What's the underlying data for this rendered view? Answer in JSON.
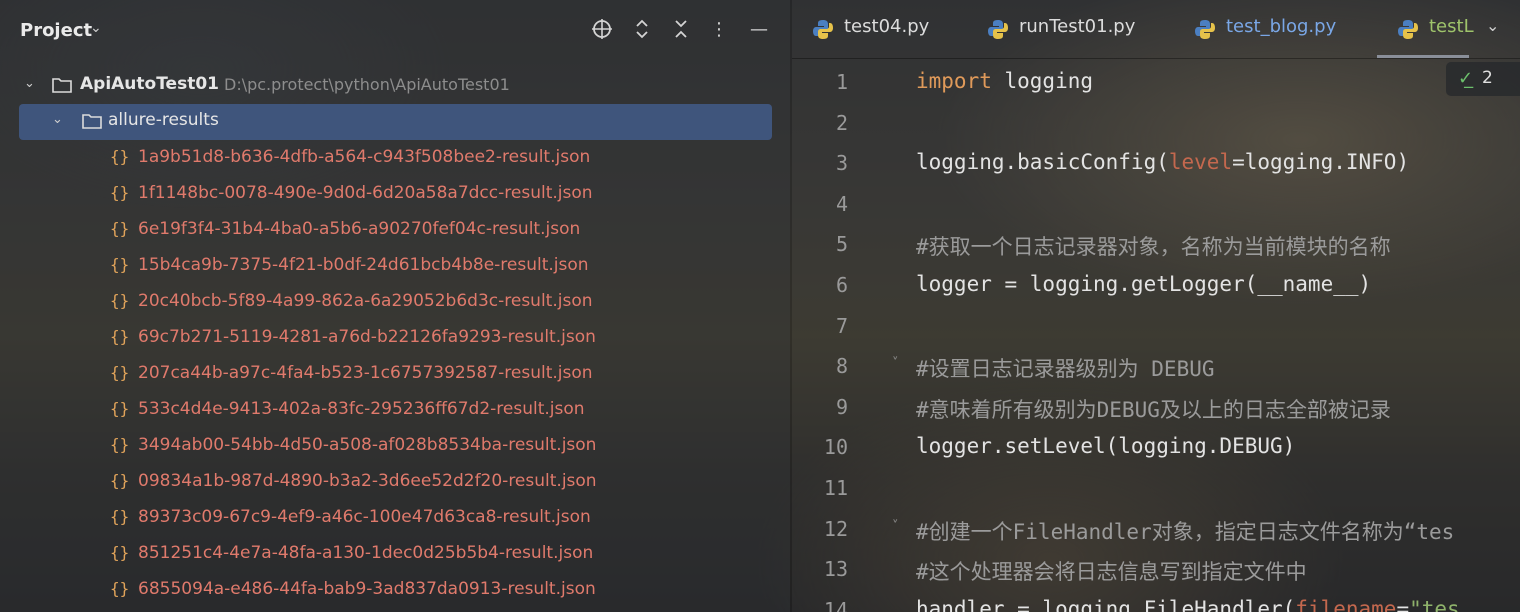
{
  "project_panel": {
    "title": "Project",
    "header_icons": [
      "locate-icon",
      "expand-collapse-icon",
      "collapse-all-icon",
      "more-icon",
      "minimize-icon"
    ],
    "root": {
      "name": "ApiAutoTest01",
      "path": "D:\\pc.protect\\python\\ApiAutoTest01"
    },
    "folder": {
      "name": "allure-results"
    },
    "files": [
      "1a9b51d8-b636-4dfb-a564-c943f508bee2-result.json",
      "1f1148bc-0078-490e-9d0d-6d20a58a7dcc-result.json",
      "6e19f3f4-31b4-4ba0-a5b6-a90270fef04c-result.json",
      "15b4ca9b-7375-4f21-b0df-24d61bcb4b8e-result.json",
      "20c40bcb-5f89-4a99-862a-6a29052b6d3c-result.json",
      "69c7b271-5119-4281-a76d-b22126fa9293-result.json",
      "207ca44b-a97c-4fa4-b523-1c6757392587-result.json",
      "533c4d4e-9413-402a-83fc-295236ff67d2-result.json",
      "3494ab00-54bb-4d50-a508-af028b8534ba-result.json",
      "09834a1b-987d-4890-b3a2-3d6ee52d2f20-result.json",
      "89373c09-67c9-4ef9-a46c-100e47d63ca8-result.json",
      "851251c4-4e7a-48fa-a130-1dec0d25b5b4-result.json",
      "6855094a-e486-44fa-bab9-3ad837da0913-result.json"
    ],
    "json_icon_glyph": "{}"
  },
  "editor": {
    "tabs": [
      {
        "label": "test04.py"
      },
      {
        "label": "runTest01.py"
      },
      {
        "label": "test_blog.py"
      },
      {
        "label": "testL"
      }
    ],
    "inspection_count": "2",
    "lines": [
      {
        "n": "1",
        "kw": "import",
        "rest": " logging"
      },
      {
        "n": "2"
      },
      {
        "n": "3",
        "a": "logging.basicConfig(",
        "param": "level",
        "b": "=logging.INFO)"
      },
      {
        "n": "4"
      },
      {
        "n": "5",
        "comment": "#获取一个日志记录器对象，名称为当前模块的名称"
      },
      {
        "n": "6",
        "text": "logger = logging.getLogger(__name__)"
      },
      {
        "n": "7"
      },
      {
        "n": "8",
        "comment": "#设置日志记录器级别为 DEBUG"
      },
      {
        "n": "9",
        "comment": "#意味着所有级别为DEBUG及以上的日志全部被记录"
      },
      {
        "n": "10",
        "text": "logger.setLevel(logging.DEBUG)"
      },
      {
        "n": "11"
      },
      {
        "n": "12",
        "comment": "#创建一个FileHandler对象，指定日志文件名称为“tes"
      },
      {
        "n": "13",
        "comment": "#这个处理器会将日志信息写到指定文件中"
      },
      {
        "n": "14",
        "a": "handler = logging.FileHandler(",
        "param": "filename",
        "b": "=",
        "str": "\"tes"
      }
    ]
  }
}
